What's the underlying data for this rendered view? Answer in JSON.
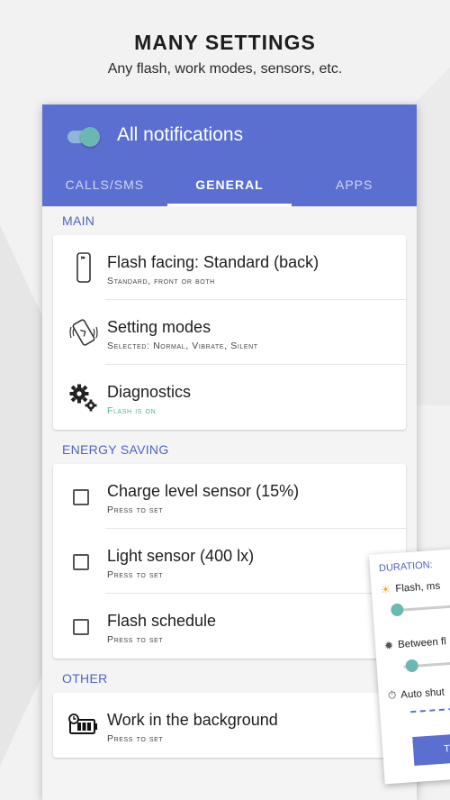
{
  "header": {
    "title": "MANY SETTINGS",
    "subtitle": "Any flash, work modes, sensors, etc."
  },
  "appbar": {
    "toggle_on": true,
    "title": "All notifications"
  },
  "tabs": [
    {
      "label": "CALLS/SMS",
      "active": false
    },
    {
      "label": "GENERAL",
      "active": true
    },
    {
      "label": "APPS",
      "active": false
    }
  ],
  "sections": {
    "main": {
      "label": "MAIN",
      "items": [
        {
          "title": "Flash facing: Standard (back)",
          "sub": "Standard, front or both",
          "icon": "phone-icon"
        },
        {
          "title": "Setting modes",
          "sub": "Selected: Normal, Vibrate, Silent",
          "icon": "vibrate-phone-icon"
        },
        {
          "title": "Diagnostics",
          "sub": "Flash is on",
          "icon": "gears-icon"
        }
      ]
    },
    "energy": {
      "label": "ENERGY SAVING",
      "items": [
        {
          "title": "Charge level sensor (15%)",
          "sub": "Press to set",
          "checked": false
        },
        {
          "title": "Light sensor (400 lx)",
          "sub": "Press to set",
          "checked": false
        },
        {
          "title": "Flash schedule",
          "sub": "Press to set",
          "checked": false
        }
      ]
    },
    "other": {
      "label": "OTHER",
      "items": [
        {
          "title": "Work in the background",
          "sub": "Press to set",
          "icon": "battery-clock-icon"
        }
      ]
    }
  },
  "overlay": {
    "label": "DURATION:",
    "flash_label": "Flash, ms",
    "between_label": "Between fl",
    "auto_label": "Auto shut",
    "button_label": "TES"
  },
  "colors": {
    "primary": "#5b6fd1",
    "accent": "#6bb8b2",
    "section_text": "#4f63c4"
  }
}
